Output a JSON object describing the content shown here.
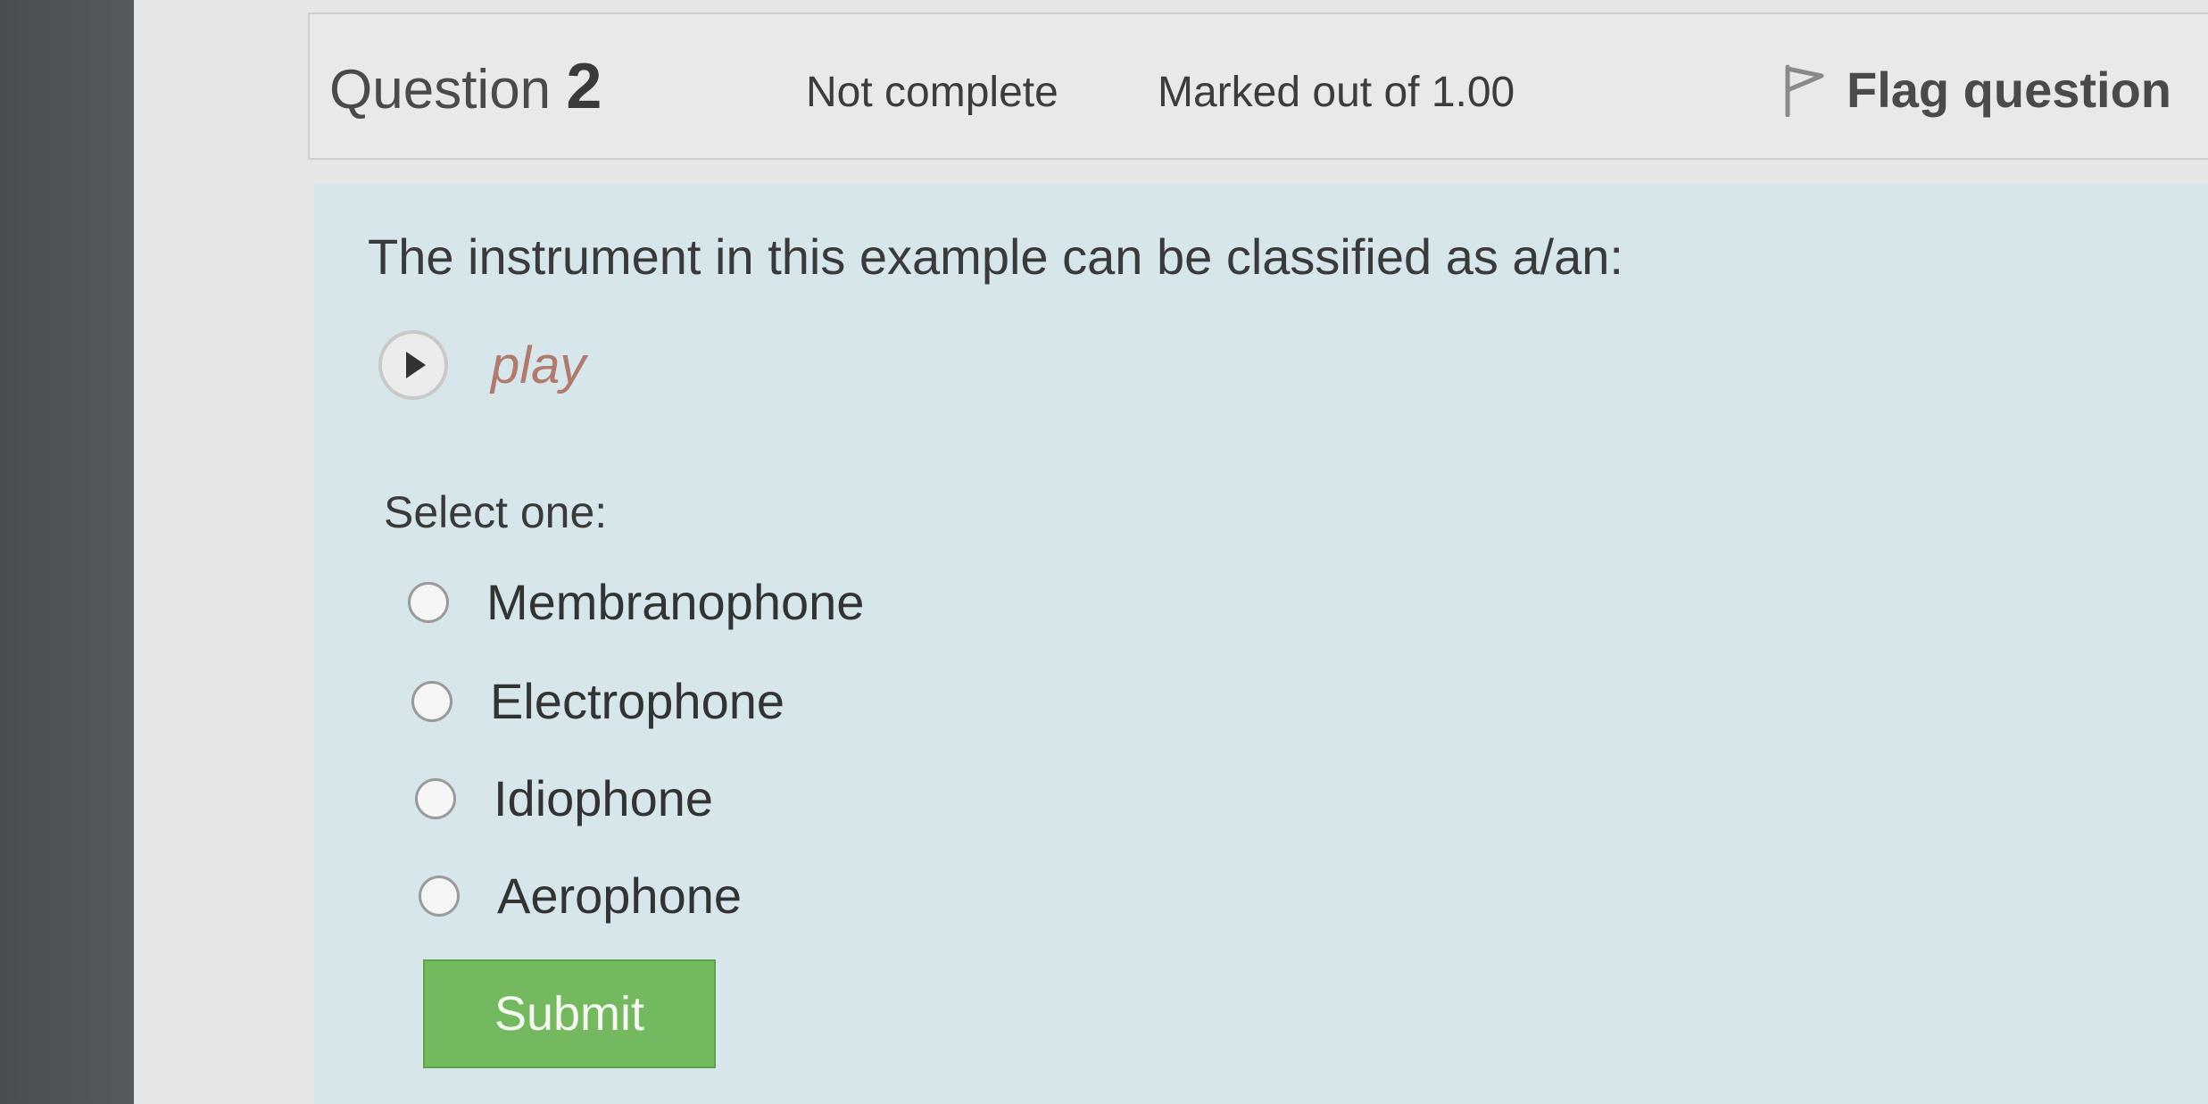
{
  "question": {
    "title_prefix": "Question",
    "number": "2",
    "status": "Not complete",
    "grade": "Marked out of 1.00",
    "flag_label": "Flag question"
  },
  "content": {
    "question_text": "The instrument in this example can be classified as a/an:",
    "play_label": "play",
    "select_prompt": "Select one:",
    "options": [
      {
        "label": "Membranophone",
        "selected": false
      },
      {
        "label": "Electrophone",
        "selected": false
      },
      {
        "label": "Idiophone",
        "selected": false
      },
      {
        "label": "Aerophone",
        "selected": false
      }
    ],
    "submit_label": "Submit"
  },
  "icons": {
    "flag": "flag-icon",
    "play": "play-icon",
    "radio": "radio-unchecked-icon"
  },
  "colors": {
    "content_background": "#d6e6ea",
    "info_background": "#e9e9e9",
    "submit_background": "#74b95f",
    "play_label": "#b07a6e"
  }
}
